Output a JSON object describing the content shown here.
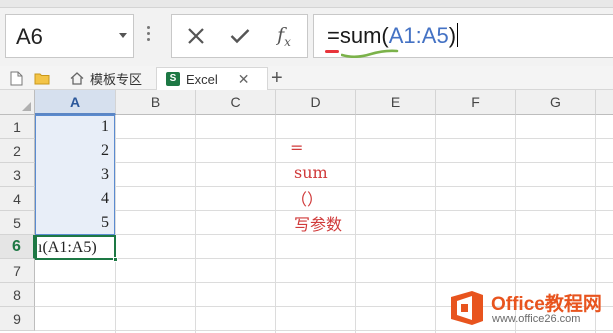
{
  "formula_bar": {
    "name_box": "A6",
    "formula_parts": [
      "=",
      "sum",
      "(",
      "A1:A5",
      ")"
    ],
    "cancel_icon": "x-icon",
    "enter_icon": "checkmark-icon",
    "function_icon": "fx-icon"
  },
  "tabs": {
    "items": [
      {
        "label": "模板专区",
        "icon": "home-icon"
      },
      {
        "label": "Excel",
        "icon": "excel-icon",
        "active": true
      }
    ],
    "new_tab": "+"
  },
  "sheet": {
    "columns": [
      "A",
      "B",
      "C",
      "D",
      "E",
      "F",
      "G"
    ],
    "rows": [
      "1",
      "2",
      "3",
      "4",
      "5",
      "6",
      "7",
      "8",
      "9"
    ],
    "active_row": "6",
    "values_a": [
      "1",
      "2",
      "3",
      "4",
      "5"
    ],
    "active_cell_text": "ı(A1:A5)",
    "annotations": [
      "=",
      "sum",
      "（）",
      "写参数"
    ]
  },
  "watermark": {
    "name": "Office教程网",
    "url": "www.office26.com"
  },
  "colors": {
    "accent_green": "#1d7844",
    "selection_blue": "#5a8bd0",
    "annotation_red": "#d03a3a",
    "logo_orange": "#e8541e"
  }
}
